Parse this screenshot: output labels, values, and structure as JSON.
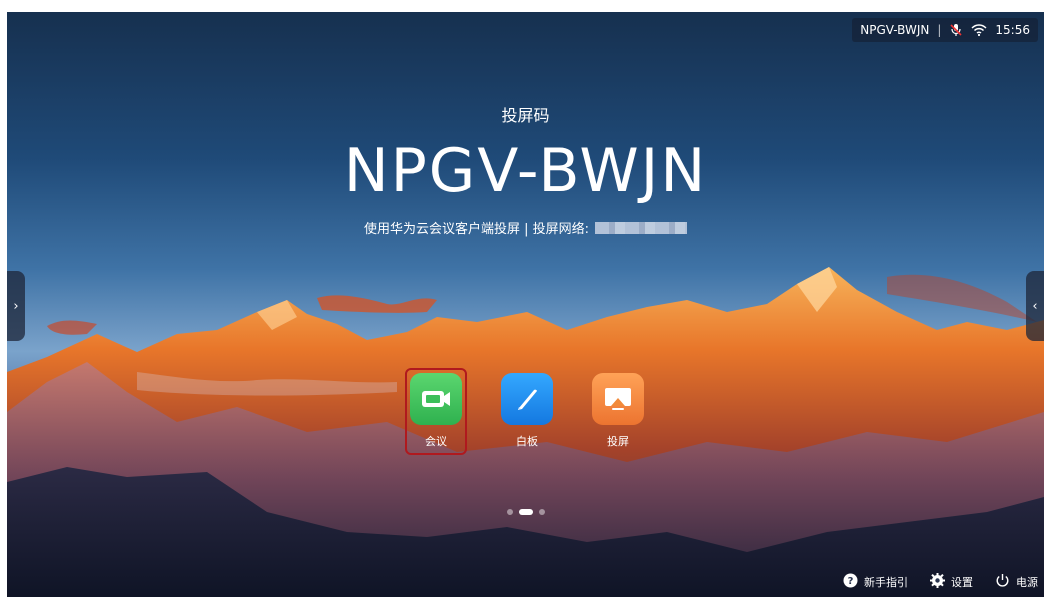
{
  "status_bar": {
    "code": "NPGV-BWJN",
    "separator": "|",
    "time": "15:56"
  },
  "projection": {
    "label": "投屏码",
    "code": "NPGV-BWJN",
    "hint": "使用华为云会议客户端投屏 | 投屏网络: "
  },
  "apps": [
    {
      "label": "会议",
      "icon": "video-camera-icon",
      "color": "#39c25b",
      "selected": true
    },
    {
      "label": "白板",
      "icon": "pen-icon",
      "color": "#1f8ff2",
      "selected": false
    },
    {
      "label": "投屏",
      "icon": "screen-cast-icon",
      "color": "#f28a3a",
      "selected": false
    }
  ],
  "pager": {
    "count": 3,
    "active_index": 1
  },
  "bottom_bar": {
    "guide_label": "新手指引",
    "settings_label": "设置",
    "power_label": "电源"
  },
  "side_tabs": {
    "left": "›",
    "right": "‹"
  }
}
